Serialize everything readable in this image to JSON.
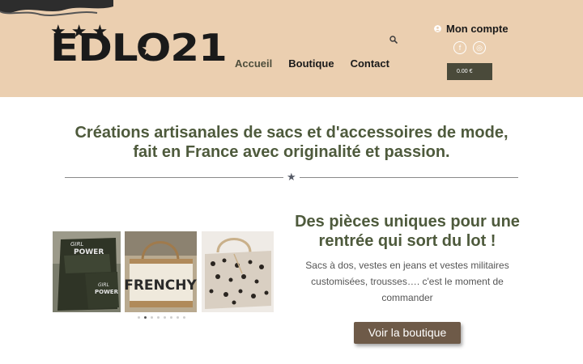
{
  "brand": {
    "logo_text": "EDLO21"
  },
  "nav": {
    "items": [
      {
        "label": "Accueil",
        "active": true
      },
      {
        "label": "Boutique",
        "active": false
      },
      {
        "label": "Contact",
        "active": false
      }
    ]
  },
  "header": {
    "search_icon": "search-icon",
    "account_label": "Mon compte",
    "socials": [
      {
        "icon": "facebook-icon",
        "glyph": "f"
      },
      {
        "icon": "instagram-icon",
        "glyph": "◎"
      }
    ],
    "cart_total": "0.00 €"
  },
  "main": {
    "headline": "Créations artisanales de sacs et d'accessoires de mode, fait en France avec originalité et passion.",
    "promo_title": "Des pièces uniques pour une rentrée qui sort du lot !",
    "promo_text": "Sacs à dos, vestes en jeans et vestes militaires customisées, trousses…. c'est le moment de commander",
    "cta_label": "Voir la boutique"
  },
  "carousel": {
    "slides": [
      {
        "alt": "Girl Power backpack",
        "caption_top": "GIRL POWER",
        "caption_bottom": "GIRL POWER"
      },
      {
        "alt": "Frenchy tote bag",
        "caption": "FRENCHY"
      },
      {
        "alt": "Leopard print bag",
        "caption": ""
      }
    ],
    "dot_count": 8,
    "active_dot": 1
  },
  "colors": {
    "header_bg": "#ebcfb0",
    "heading_green": "#4e5a3c",
    "cart_bg": "#4a4a3a",
    "button_brown": "#6e5a48"
  }
}
